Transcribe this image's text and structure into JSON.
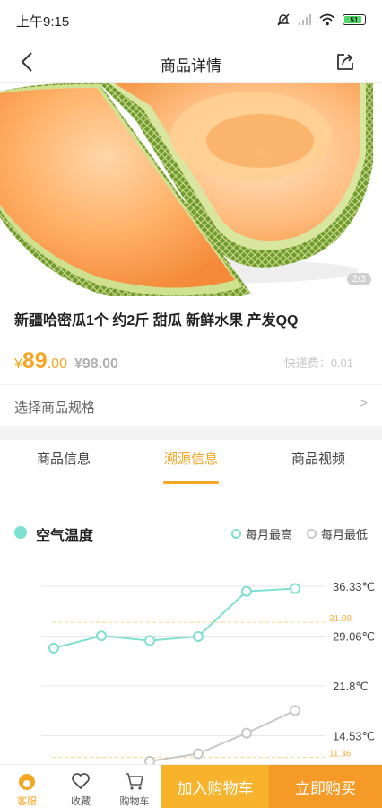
{
  "status_bar": {
    "time": "上午9:15",
    "battery": "51"
  },
  "nav": {
    "title": "商品详情"
  },
  "gallery": {
    "counter": "2/3"
  },
  "product": {
    "title": "新疆哈密瓜1个 约2斤 甜瓜 新鲜水果 产发QQ",
    "currency": "¥",
    "price_int": "89",
    "price_dec": ".00",
    "old_price": "¥98.00",
    "shipping": "快递费：0.01"
  },
  "spec": {
    "label": "选择商品规格",
    "arrow": ">"
  },
  "tabs": [
    {
      "label": "商品信息"
    },
    {
      "label": "溯源信息"
    },
    {
      "label": "商品视频"
    }
  ],
  "chart_header": {
    "title": "空气温度",
    "legend_high": "每月最高",
    "legend_low": "每月最低"
  },
  "chart_data": {
    "type": "line",
    "ticks": [
      "36.33℃",
      "29.06℃",
      "21.8℃",
      "14.53℃"
    ],
    "tick_values": [
      36.33,
      29.06,
      21.8,
      14.53
    ],
    "series": [
      {
        "name": "每月最高",
        "values": [
          27.3,
          29.1,
          28.4,
          29.0,
          35.6,
          36.0
        ],
        "color": "#7ee0d0"
      },
      {
        "name": "每月最低",
        "values": [
          null,
          null,
          10.8,
          11.9,
          14.9,
          18.2
        ],
        "color": "#c8c8c8"
      }
    ],
    "avg_lines": [
      {
        "label": "31.08",
        "value": 31.08,
        "color": "#f5d58a"
      },
      {
        "label": "11.36",
        "value": 11.36,
        "color": "#f5d58a"
      }
    ]
  },
  "bottom_bar": {
    "service_label": "客服",
    "favorite_label": "收藏",
    "cart_label": "购物车",
    "add_cart_button": "加入购物车",
    "buy_now_button": "立即购买"
  },
  "colors": {
    "accent": "#f5a623",
    "teal": "#7ee0d0"
  }
}
